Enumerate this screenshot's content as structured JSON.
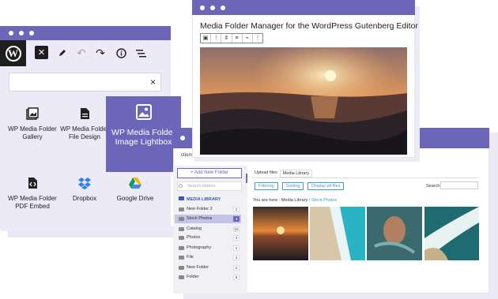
{
  "editor": {
    "close_icon": "close-icon",
    "search_clear": "×",
    "blocks": [
      {
        "label": "WP Media Folder Gallery",
        "icon": "gallery-icon"
      },
      {
        "label": "WP Media Folder File Design",
        "icon": "file-icon"
      },
      {
        "label": "WP Media Folder Image Lightbox",
        "icon": "image-icon"
      },
      {
        "label": "WP Media Folder PDF Embed",
        "icon": "code-icon"
      },
      {
        "label": "Dropbox",
        "icon": "dropbox-icon"
      },
      {
        "label": "Google Drive",
        "icon": "google-drive-icon"
      }
    ]
  },
  "gutenberg": {
    "title": "Media Folder Manager for the WordPress Gutenberg Editor"
  },
  "media": {
    "partial_label": "ctions",
    "add_folder": "+ Add New Folder",
    "search_placeholder": "Search folders",
    "library_label": "MEDIA LIBRARY",
    "folders": [
      {
        "name": "New Folder 2",
        "count": "2"
      },
      {
        "name": "Stock Photos",
        "count": "4",
        "selected": true
      },
      {
        "name": "Catalog",
        "count": "10"
      },
      {
        "name": "Photos",
        "count": "3"
      },
      {
        "name": "Photography",
        "count": "4"
      },
      {
        "name": "File",
        "count": "3"
      },
      {
        "name": "New Folder",
        "count": "2"
      },
      {
        "name": "Folder",
        "count": "8"
      }
    ],
    "tabs": [
      "Upload files",
      "Media Library"
    ],
    "filters": [
      "Filtering",
      "Sorting",
      "Display all files"
    ],
    "search_label": "Search",
    "breadcrumb_prefix": "You are here :",
    "breadcrumb_root": "Media Library",
    "breadcrumb_sep": "/",
    "breadcrumb_current": "Stock Photos"
  },
  "colors": {
    "accent": "#6b66b8",
    "link": "#3b9fd8"
  }
}
